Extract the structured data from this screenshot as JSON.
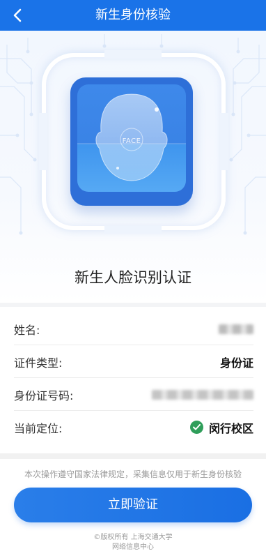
{
  "header": {
    "title": "新生身份核验",
    "back_icon": "chevron-left-icon"
  },
  "hero": {
    "face_label": "FACE",
    "title": "新生人脸识别认证"
  },
  "info_rows": [
    {
      "label": "姓名:",
      "value": "",
      "masked": true
    },
    {
      "label": "证件类型:",
      "value": "身份证",
      "masked": false
    },
    {
      "label": "身份证号码:",
      "value": "",
      "masked": true
    },
    {
      "label": "当前定位:",
      "value": "闵行校区",
      "masked": false,
      "status_icon": "check-circle-icon",
      "status_color": "#2f9e5a"
    }
  ],
  "footer": {
    "notice": "本次操作遵守国家法律规定，采集信息仅用于新生身份核验",
    "button_label": "立即验证",
    "copyright_line1": "©版权所有 上海交通大学",
    "copyright_line2": "网络信息中心"
  },
  "colors": {
    "primary": "#1a73e8",
    "success": "#2f9e5a",
    "background": "#f3f4f6"
  }
}
